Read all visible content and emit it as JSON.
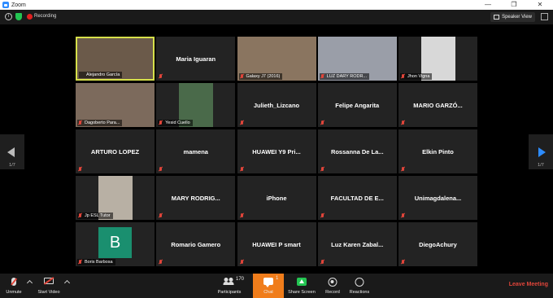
{
  "window": {
    "title": "Zoom",
    "controls": [
      "—",
      "❐",
      "✕"
    ]
  },
  "infobar": {
    "recording_label": "Recording",
    "speaker_view_label": "Speaker View"
  },
  "tiles": [
    {
      "name": "Alejandro García",
      "video": true,
      "active": true,
      "muted": false,
      "bg": "#6b5a4a"
    },
    {
      "name": "Maria Iguaran",
      "video": false,
      "muted": true
    },
    {
      "name": "Galaxy J7 (2016)",
      "video": true,
      "muted": true,
      "bg": "#8a7560"
    },
    {
      "name": "LUZ DARY RODR...",
      "video": true,
      "muted": true,
      "bg": "#9a9ea8"
    },
    {
      "name": "Jhon Vigna",
      "video": true,
      "muted": true,
      "bg": "#d8d8d8"
    },
    {
      "name": "Dagoberto Para...",
      "video": true,
      "muted": true,
      "bg": "#7c6a5c"
    },
    {
      "name": "Yesid Cuello",
      "video": true,
      "muted": true,
      "bg": "#4a6a4a"
    },
    {
      "name": "Julieth_Lizcano",
      "video": false,
      "muted": true
    },
    {
      "name": "Felipe Angarita",
      "video": false,
      "muted": true
    },
    {
      "name": "MARIO GARZÓ...",
      "video": false,
      "muted": true
    },
    {
      "name": "ARTURO LOPEZ",
      "video": false,
      "muted": true
    },
    {
      "name": "mamena",
      "video": false,
      "muted": true
    },
    {
      "name": "HUAWEI Y9 Pri...",
      "video": false,
      "muted": true
    },
    {
      "name": "Rossanna De La...",
      "video": false,
      "muted": true
    },
    {
      "name": "Elkin Pinto",
      "video": false,
      "muted": true
    },
    {
      "name": "Jp ESL Tutor",
      "video": true,
      "muted": true,
      "bg": "#b8b0a4"
    },
    {
      "name": "MARY RODRIG...",
      "video": false,
      "muted": true
    },
    {
      "name": "iPhone",
      "video": false,
      "muted": true
    },
    {
      "name": "FACULTAD DE E...",
      "video": false,
      "muted": true
    },
    {
      "name": "Unimagdalena...",
      "video": false,
      "muted": true
    },
    {
      "name": "Boris Barbosa",
      "video": false,
      "avatar": "B",
      "muted": true
    },
    {
      "name": "Romario Gamero",
      "video": false,
      "muted": true
    },
    {
      "name": "HUAWEI P smart",
      "video": false,
      "muted": true
    },
    {
      "name": "Luz Karen Zabal...",
      "video": false,
      "muted": true
    },
    {
      "name": "DiegoAchury",
      "video": false,
      "muted": true
    }
  ],
  "pager": {
    "left": "1/7",
    "right": "1/7"
  },
  "toolbar": {
    "unmute": "Unmute",
    "start_video": "Start Video",
    "participants": "Participants",
    "participants_count": "170",
    "chat": "Chat",
    "chat_count": "1",
    "share_screen": "Share Screen",
    "record": "Record",
    "reactions": "Reactions",
    "leave": "Leave Meeting"
  }
}
